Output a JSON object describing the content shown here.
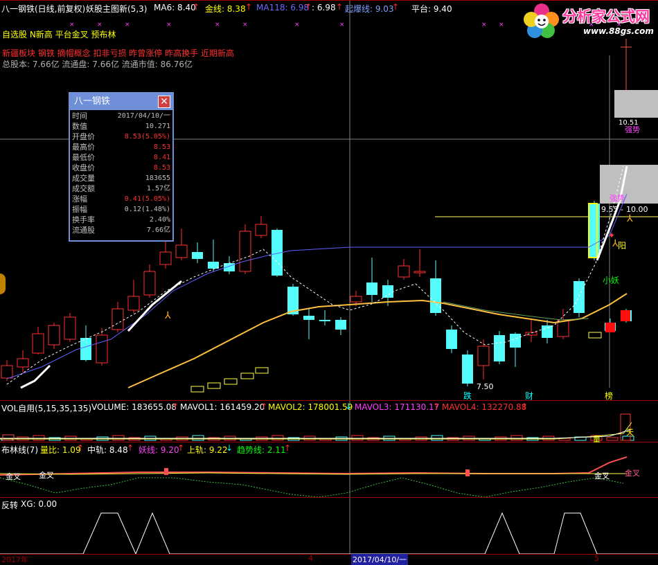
{
  "header": {
    "stock_title": "八一钢铁(日线,前复权)",
    "indicator_name": "妖股主图新(5,3)",
    "ma6": "MA6: 8.40",
    "jinxian": "金线: 8.38",
    "ma118": "MA118: 6.98",
    "ma118b": ": 6.98",
    "qibaoxian": "起爆线: 9.03",
    "pingtai": "平台: 9.40"
  },
  "tags": {
    "line1": "自选股 N新高 平台金叉 预布林",
    "line2": "新疆板块 钢铁 摘帽概念 扣非亏损 昨曾涨停 昨高换手 近期新高",
    "line3": "总股本: 7.66亿 流通盘: 7.66亿 流通市值: 86.76亿"
  },
  "logo": {
    "text": "分析家公式网",
    "url": "www.88gs.com"
  },
  "popup": {
    "title": "八一钢铁",
    "close_label": "✕",
    "rows": [
      {
        "k": "时间",
        "v": "2017/04/10/一",
        "up": false
      },
      {
        "k": "数值",
        "v": "10.271",
        "up": false
      },
      {
        "k": "开盘价",
        "v": "8.53(5.05%)",
        "up": true
      },
      {
        "k": "最高价",
        "v": "8.53",
        "up": true
      },
      {
        "k": "最低价",
        "v": "8.41",
        "up": true
      },
      {
        "k": "收盘价",
        "v": "8.53",
        "up": true
      },
      {
        "k": "成交量",
        "v": "183655",
        "up": false
      },
      {
        "k": "成交额",
        "v": "1.57亿",
        "up": false
      },
      {
        "k": "涨幅",
        "v": "0.41(5.05%)",
        "up": true
      },
      {
        "k": "振幅",
        "v": "0.12(1.48%)",
        "up": false
      },
      {
        "k": "换手率",
        "v": "2.40%",
        "up": false
      },
      {
        "k": "流通股",
        "v": "7.66亿",
        "up": false
      }
    ]
  },
  "chart_labels": {
    "price_1051": "10.51",
    "strong": "强势",
    "strong2": "强势",
    "price_955": "9.55",
    "price_1000": "10.00",
    "yang": "阳",
    "xiaoyao": "小妖",
    "low_750": "7.50",
    "die": "跌",
    "cai": "财",
    "bang": "榜",
    "liang": "量",
    "tian": "天",
    "jincha1": "金叉",
    "jincha2": "金叉",
    "jincha3": "金叉",
    "jincha4": "金叉"
  },
  "vol_panel": {
    "name": "VOL自用(5,15,35,135)",
    "volume": "VOLUME: 183655.08",
    "mavol1": "MAVOL1: 161459.20",
    "mavol2": "MAVOL2: 178001.59",
    "mavol3": "MAVOL3: 171130.17",
    "mavol4": "MAVOL4: 132270.88"
  },
  "boll_panel": {
    "name": "布林线(7)",
    "liangbi": "量比: 1.09",
    "zhonggui": "中轨: 8.48",
    "yaoxian": "妖线: 9.20",
    "shanggui": "上轨: 9.22",
    "qushixian": "趋势线: 2.11"
  },
  "fz_panel": {
    "name": "反转",
    "xg": "XG: 0.00"
  },
  "axis": {
    "year": "2017年",
    "month": "4",
    "date_cursor": "2017/04/10/一",
    "end_mark": "5"
  },
  "colors": {
    "up": "#ff3030",
    "down": "#54fcfc",
    "border": "#a00000",
    "ma_yellow": "#ffc040",
    "ma_blue": "#6060ff"
  }
}
